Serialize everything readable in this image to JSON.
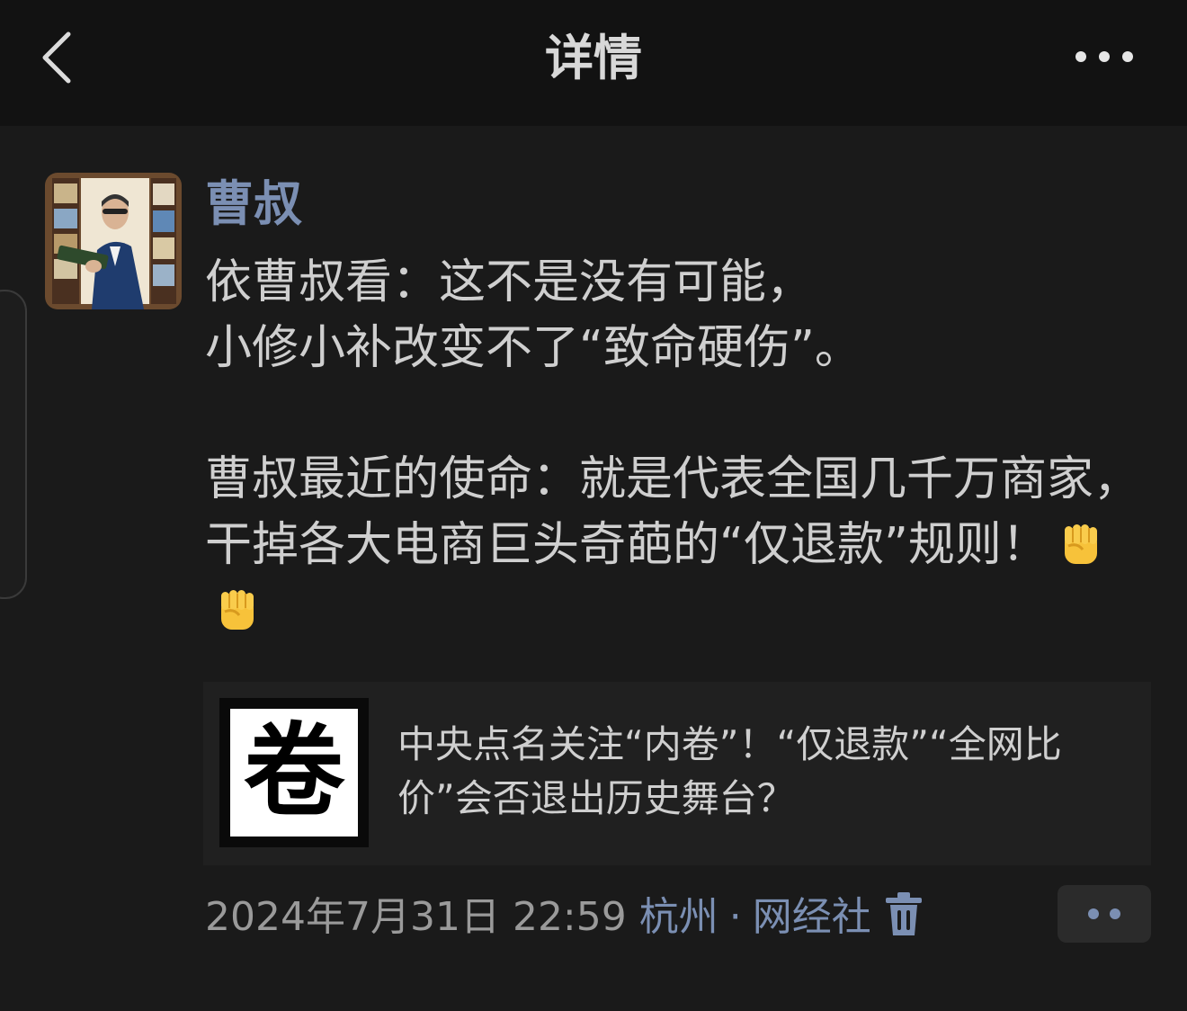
{
  "header": {
    "title": "详情",
    "back_icon": "chevron-left-icon",
    "more_icon": "ellipsis-icon"
  },
  "post": {
    "author": "曹叔",
    "lines": [
      "依曹叔看：这不是没有可能，",
      "小修小补改变不了“致命硬伤”。",
      "曹叔最近的使命：就是代表全国几千万商家，干掉各大电商巨头奇葩的“仅退款”规则！"
    ],
    "emoji": [
      "raised-fist-icon",
      "raised-fist-icon"
    ],
    "linked_article": {
      "thumbnail_text": "卷",
      "title": "中央点名关注“内卷”！“仅退款”“全网比价”会否退出历史舞台？"
    },
    "meta": {
      "datetime": "2024年7月31日 22:59",
      "location": "杭州",
      "separator": "·",
      "source": "网经社",
      "delete_icon": "trash-icon"
    }
  },
  "colors": {
    "background": "#1a1a1a",
    "header_bg": "#121212",
    "link_blue": "#7b8fb3",
    "text": "#cfcfcf",
    "muted": "#9a9a9a"
  }
}
